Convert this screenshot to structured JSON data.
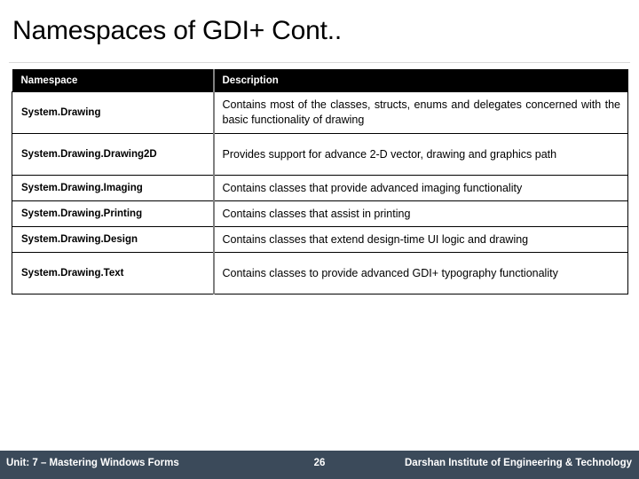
{
  "slide": {
    "title": "Namespaces of GDI+ Cont..",
    "accent_color": "#3b4a5a",
    "header_bg": "#000000",
    "header_fg": "#ffffff",
    "divider_color": "#808080"
  },
  "table": {
    "columns": [
      {
        "label": "Namespace"
      },
      {
        "label": "Description"
      }
    ],
    "rows": [
      {
        "namespace": "System.Drawing",
        "description": "Contains most of the classes, structs, enums and delegates concerned with the basic functionality of drawing",
        "lines": 2
      },
      {
        "namespace": "System.Drawing.Drawing2D",
        "description": "Provides support for advance 2-D vector, drawing and graphics path",
        "lines": 2
      },
      {
        "namespace": "System.Drawing.Imaging",
        "description": "Contains classes that provide advanced imaging functionality",
        "lines": 1
      },
      {
        "namespace": "System.Drawing.Printing",
        "description": "Contains classes that assist in printing",
        "lines": 1
      },
      {
        "namespace": "System.Drawing.Design",
        "description": "Contains classes that extend design-time UI logic and drawing",
        "lines": 1
      },
      {
        "namespace": "System.Drawing.Text",
        "description": "Contains classes to provide advanced GDI+ typography functionality",
        "lines": 2
      }
    ]
  },
  "footer": {
    "left": "Unit: 7 – Mastering Windows Forms",
    "page_number": "26",
    "right": "Darshan Institute of Engineering & Technology"
  }
}
